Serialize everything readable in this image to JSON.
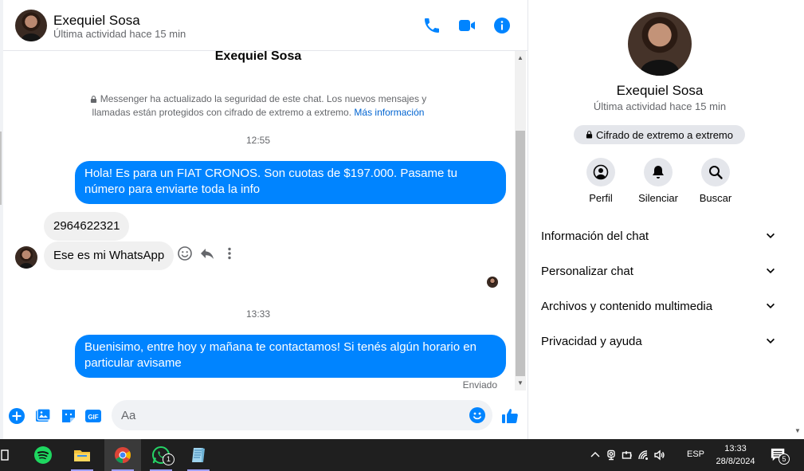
{
  "header": {
    "name": "Exequiel Sosa",
    "status": "Última actividad hace 15 min"
  },
  "conversation": {
    "name": "Exequiel Sosa",
    "security_text": "Messenger ha actualizado la seguridad de este chat. Los nuevos mensajes y llamadas están protegidos con cifrado de extremo a extremo.",
    "security_link": "Más información",
    "messages": [
      {
        "time": "12:55"
      },
      {
        "from": "me",
        "text": "Hola! Es para un FIAT CRONOS. Son cuotas de $197.000. Pasame tu número para enviarte toda la info"
      },
      {
        "from": "them",
        "text": "2964622321"
      },
      {
        "from": "them",
        "text": "Ese es mi WhatsApp"
      },
      {
        "time": "13:33"
      },
      {
        "from": "me",
        "text": "Buenisimo, entre hoy y mañana te contactamos! Si tenés algún horario en particular avisame"
      }
    ],
    "sent_status": "Enviado"
  },
  "composer": {
    "placeholder": "Aa"
  },
  "panel": {
    "name": "Exequiel Sosa",
    "status": "Última actividad hace 15 min",
    "encryption_badge": "Cifrado de extremo a extremo",
    "actions": [
      {
        "label": "Perfil",
        "icon": "profile-icon"
      },
      {
        "label": "Silenciar",
        "icon": "bell-icon"
      },
      {
        "label": "Buscar",
        "icon": "search-icon"
      }
    ],
    "sections": [
      "Información del chat",
      "Personalizar chat",
      "Archivos y contenido multimedia",
      "Privacidad y ayuda"
    ]
  },
  "taskbar": {
    "whatsapp_badge": "1",
    "language": "ESP",
    "time": "13:33",
    "date": "28/8/2024",
    "notification_count": "5"
  },
  "colors": {
    "accent": "#0084ff",
    "bubble_in": "#f0f0f0",
    "muted_text": "#65676b",
    "taskbar": "#1f1f1f"
  }
}
